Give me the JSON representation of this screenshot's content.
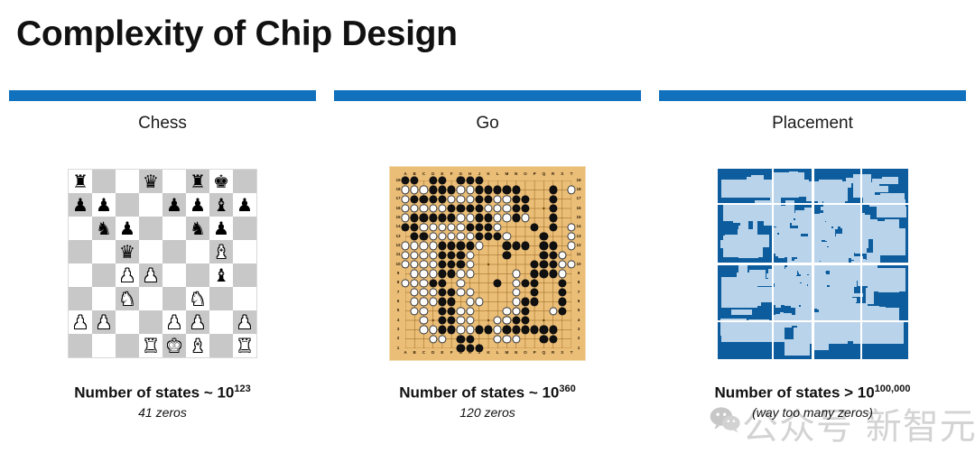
{
  "slide": {
    "title": "Complexity of Chip Design",
    "accent_color": "#1271bd",
    "background": "#ffffff"
  },
  "columns": [
    {
      "id": "chess",
      "label": "Chess",
      "figure": "chess-board",
      "caption_main_prefix": "Number of states ~ 10",
      "caption_exponent": "123",
      "caption_sub": "41 zeros"
    },
    {
      "id": "go",
      "label": "Go",
      "figure": "go-board",
      "caption_main_prefix": "Number of states ~ 10",
      "caption_exponent": "360",
      "caption_sub": "120 zeros"
    },
    {
      "id": "placement",
      "label": "Placement",
      "figure": "chip-floorplan",
      "caption_main_prefix": "Number of states > 10",
      "caption_exponent": "100,000",
      "caption_sub": "(way too many zeros)"
    }
  ],
  "chess": {
    "light_square_color": "#ffffff",
    "dark_square_color": "#c8c8c8",
    "ranks": [
      [
        "r",
        "",
        "",
        "q",
        "",
        "r",
        "k",
        ""
      ],
      [
        "p",
        "p",
        "",
        "",
        "p",
        "p",
        "b",
        "p"
      ],
      [
        "",
        "n",
        "p",
        "",
        "",
        "n",
        "p",
        ""
      ],
      [
        "",
        "",
        "q",
        "",
        "",
        "",
        "B",
        ""
      ],
      [
        "",
        "",
        "P",
        "P",
        "",
        "",
        "b",
        ""
      ],
      [
        "",
        "",
        "N",
        "",
        "",
        "N",
        "",
        ""
      ],
      [
        "P",
        "P",
        "",
        "",
        "P",
        "P",
        "",
        "P"
      ],
      [
        "",
        "",
        "",
        "R",
        "K",
        "B",
        "",
        "R"
      ]
    ],
    "glyphs": {
      "k": "♚",
      "q": "♛",
      "r": "♜",
      "b": "♝",
      "n": "♞",
      "p": "♟",
      "K": "♚",
      "Q": "♛",
      "R": "♜",
      "B": "♝",
      "N": "♞",
      "P": "♟"
    }
  },
  "go": {
    "size": 19,
    "board_color": "#ebbe78",
    "border_color": "#f3dcb2",
    "column_labels": [
      "A",
      "B",
      "C",
      "D",
      "E",
      "F",
      "G",
      "H",
      "J",
      "K",
      "L",
      "M",
      "N",
      "O",
      "P",
      "Q",
      "R",
      "S",
      "T"
    ],
    "row_labels": [
      "19",
      "18",
      "17",
      "16",
      "15",
      "14",
      "13",
      "12",
      "11",
      "10",
      "9",
      "8",
      "7",
      "6",
      "5",
      "4",
      "3",
      "2",
      "1"
    ],
    "black_stones": [
      [
        1,
        19
      ],
      [
        2,
        19
      ],
      [
        4,
        19
      ],
      [
        5,
        19
      ],
      [
        7,
        19
      ],
      [
        8,
        19
      ],
      [
        9,
        19
      ],
      [
        4,
        18
      ],
      [
        5,
        18
      ],
      [
        6,
        18
      ],
      [
        9,
        18
      ],
      [
        10,
        18
      ],
      [
        11,
        18
      ],
      [
        12,
        18
      ],
      [
        13,
        18
      ],
      [
        17,
        18
      ],
      [
        2,
        17
      ],
      [
        3,
        17
      ],
      [
        4,
        17
      ],
      [
        5,
        17
      ],
      [
        9,
        17
      ],
      [
        10,
        17
      ],
      [
        13,
        17
      ],
      [
        14,
        17
      ],
      [
        17,
        17
      ],
      [
        6,
        16
      ],
      [
        7,
        16
      ],
      [
        8,
        16
      ],
      [
        9,
        16
      ],
      [
        13,
        16
      ],
      [
        14,
        16
      ],
      [
        17,
        16
      ],
      [
        2,
        15
      ],
      [
        3,
        15
      ],
      [
        4,
        15
      ],
      [
        5,
        15
      ],
      [
        6,
        15
      ],
      [
        9,
        15
      ],
      [
        10,
        15
      ],
      [
        13,
        15
      ],
      [
        17,
        15
      ],
      [
        1,
        14
      ],
      [
        2,
        14
      ],
      [
        8,
        14
      ],
      [
        9,
        14
      ],
      [
        10,
        14
      ],
      [
        15,
        14
      ],
      [
        17,
        14
      ],
      [
        2,
        13
      ],
      [
        3,
        13
      ],
      [
        9,
        13
      ],
      [
        10,
        13
      ],
      [
        11,
        13
      ],
      [
        16,
        13
      ],
      [
        5,
        12
      ],
      [
        6,
        12
      ],
      [
        7,
        12
      ],
      [
        8,
        12
      ],
      [
        12,
        12
      ],
      [
        13,
        12
      ],
      [
        14,
        12
      ],
      [
        16,
        12
      ],
      [
        17,
        12
      ],
      [
        5,
        11
      ],
      [
        6,
        11
      ],
      [
        7,
        11
      ],
      [
        12,
        11
      ],
      [
        16,
        11
      ],
      [
        17,
        11
      ],
      [
        18,
        11
      ],
      [
        5,
        10
      ],
      [
        6,
        10
      ],
      [
        7,
        10
      ],
      [
        15,
        10
      ],
      [
        16,
        10
      ],
      [
        17,
        10
      ],
      [
        5,
        9
      ],
      [
        6,
        9
      ],
      [
        15,
        9
      ],
      [
        16,
        9
      ],
      [
        17,
        9
      ],
      [
        4,
        8
      ],
      [
        5,
        8
      ],
      [
        11,
        8
      ],
      [
        14,
        8
      ],
      [
        15,
        8
      ],
      [
        18,
        8
      ],
      [
        5,
        7
      ],
      [
        6,
        7
      ],
      [
        15,
        7
      ],
      [
        18,
        7
      ],
      [
        5,
        6
      ],
      [
        6,
        6
      ],
      [
        14,
        6
      ],
      [
        15,
        6
      ],
      [
        18,
        6
      ],
      [
        5,
        5
      ],
      [
        6,
        5
      ],
      [
        13,
        5
      ],
      [
        14,
        5
      ],
      [
        18,
        5
      ],
      [
        5,
        4
      ],
      [
        6,
        4
      ],
      [
        12,
        4
      ],
      [
        13,
        4
      ],
      [
        14,
        4
      ],
      [
        5,
        3
      ],
      [
        6,
        3
      ],
      [
        9,
        3
      ],
      [
        10,
        3
      ],
      [
        12,
        3
      ],
      [
        13,
        3
      ],
      [
        14,
        3
      ],
      [
        15,
        3
      ],
      [
        16,
        3
      ],
      [
        17,
        3
      ],
      [
        7,
        2
      ],
      [
        8,
        2
      ],
      [
        16,
        2
      ],
      [
        17,
        2
      ],
      [
        7,
        1
      ],
      [
        8,
        1
      ],
      [
        9,
        1
      ]
    ],
    "white_stones": [
      [
        1,
        18
      ],
      [
        2,
        18
      ],
      [
        3,
        18
      ],
      [
        7,
        18
      ],
      [
        8,
        18
      ],
      [
        19,
        18
      ],
      [
        1,
        17
      ],
      [
        6,
        17
      ],
      [
        7,
        17
      ],
      [
        8,
        17
      ],
      [
        11,
        17
      ],
      [
        12,
        17
      ],
      [
        1,
        16
      ],
      [
        2,
        16
      ],
      [
        3,
        16
      ],
      [
        4,
        16
      ],
      [
        5,
        16
      ],
      [
        10,
        16
      ],
      [
        11,
        16
      ],
      [
        12,
        16
      ],
      [
        1,
        15
      ],
      [
        7,
        15
      ],
      [
        8,
        15
      ],
      [
        11,
        15
      ],
      [
        12,
        15
      ],
      [
        14,
        15
      ],
      [
        3,
        14
      ],
      [
        4,
        14
      ],
      [
        5,
        14
      ],
      [
        6,
        14
      ],
      [
        7,
        14
      ],
      [
        11,
        14
      ],
      [
        19,
        14
      ],
      [
        4,
        13
      ],
      [
        5,
        13
      ],
      [
        6,
        13
      ],
      [
        7,
        13
      ],
      [
        8,
        13
      ],
      [
        12,
        13
      ],
      [
        19,
        13
      ],
      [
        1,
        12
      ],
      [
        2,
        12
      ],
      [
        3,
        12
      ],
      [
        4,
        12
      ],
      [
        9,
        12
      ],
      [
        19,
        12
      ],
      [
        1,
        11
      ],
      [
        2,
        11
      ],
      [
        3,
        11
      ],
      [
        4,
        11
      ],
      [
        8,
        11
      ],
      [
        18,
        11
      ],
      [
        1,
        10
      ],
      [
        2,
        10
      ],
      [
        3,
        10
      ],
      [
        4,
        10
      ],
      [
        8,
        10
      ],
      [
        18,
        10
      ],
      [
        19,
        10
      ],
      [
        2,
        9
      ],
      [
        3,
        9
      ],
      [
        4,
        9
      ],
      [
        7,
        9
      ],
      [
        8,
        9
      ],
      [
        13,
        9
      ],
      [
        18,
        9
      ],
      [
        1,
        8
      ],
      [
        2,
        8
      ],
      [
        3,
        8
      ],
      [
        7,
        8
      ],
      [
        13,
        8
      ],
      [
        2,
        7
      ],
      [
        3,
        7
      ],
      [
        4,
        7
      ],
      [
        7,
        7
      ],
      [
        8,
        7
      ],
      [
        13,
        7
      ],
      [
        2,
        6
      ],
      [
        3,
        6
      ],
      [
        4,
        6
      ],
      [
        8,
        6
      ],
      [
        9,
        6
      ],
      [
        13,
        6
      ],
      [
        2,
        5
      ],
      [
        3,
        5
      ],
      [
        7,
        5
      ],
      [
        8,
        5
      ],
      [
        12,
        5
      ],
      [
        13,
        5
      ],
      [
        17,
        5
      ],
      [
        3,
        4
      ],
      [
        7,
        4
      ],
      [
        8,
        4
      ],
      [
        11,
        4
      ],
      [
        12,
        4
      ],
      [
        3,
        3
      ],
      [
        4,
        3
      ],
      [
        7,
        3
      ],
      [
        8,
        3
      ],
      [
        11,
        3
      ],
      [
        4,
        2
      ],
      [
        5,
        2
      ],
      [
        11,
        2
      ],
      [
        12,
        2
      ],
      [
        13,
        2
      ]
    ]
  },
  "placement": {
    "background_color": "#0c5c9e",
    "block_color": "#b9d4ea",
    "description": "chip floorplan with macro blocks"
  },
  "watermark": {
    "text": "公众号 新智元",
    "logo": "wechat-logo"
  }
}
